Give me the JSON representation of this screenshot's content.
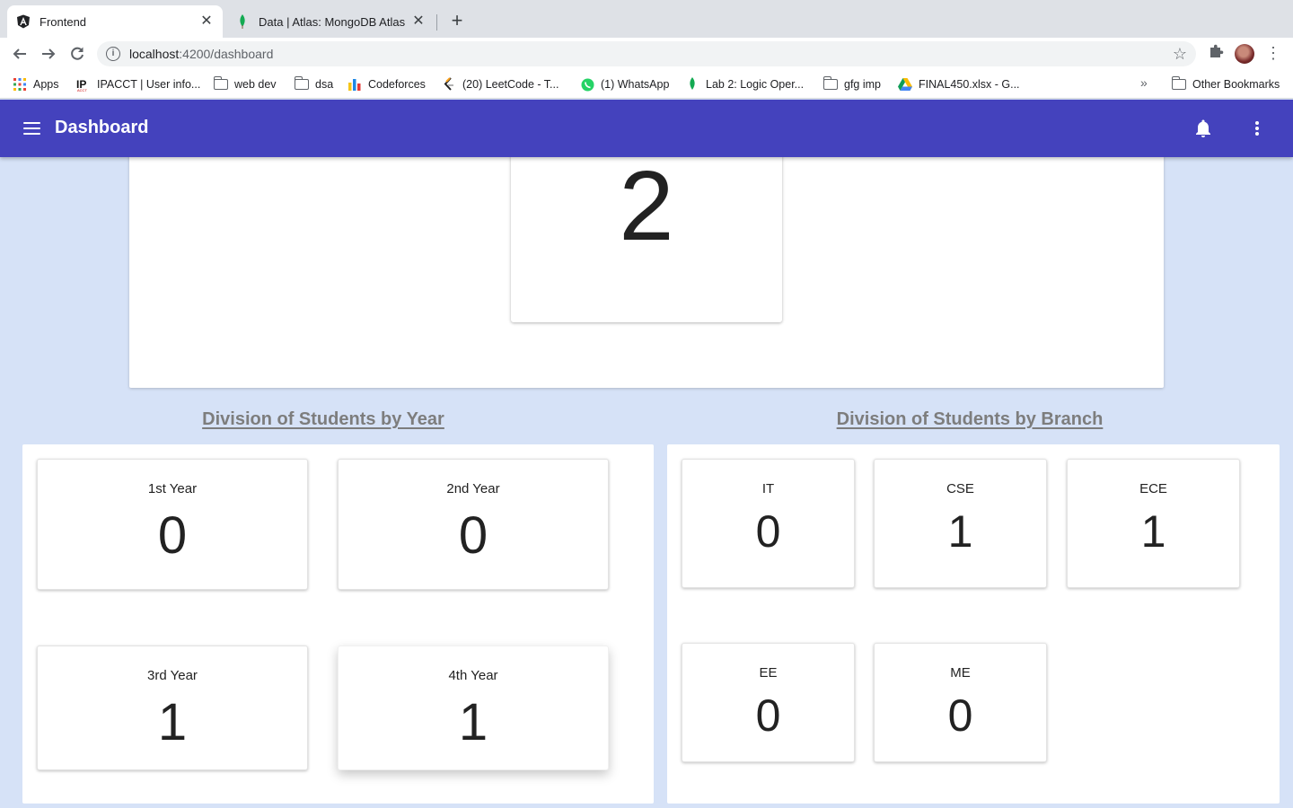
{
  "browser": {
    "tabs": [
      {
        "title": "Frontend",
        "icon": "angular-icon"
      },
      {
        "title": "Data | Atlas: MongoDB Atlas",
        "icon": "mongodb-leaf-icon"
      }
    ],
    "url_host": "localhost",
    "url_path": ":4200/dashboard",
    "bookmarks": [
      {
        "label": "Apps",
        "icon": "apps-grid-icon"
      },
      {
        "label": "IPACCT | User info...",
        "icon": "ipacct-icon"
      },
      {
        "label": "web dev",
        "icon": "folder-icon"
      },
      {
        "label": "dsa",
        "icon": "folder-icon"
      },
      {
        "label": "Codeforces",
        "icon": "codeforces-icon"
      },
      {
        "label": "(20) LeetCode - T...",
        "icon": "leetcode-icon"
      },
      {
        "label": "(1) WhatsApp",
        "icon": "whatsapp-icon"
      },
      {
        "label": "Lab 2: Logic Oper...",
        "icon": "mongodb-leaf-icon"
      },
      {
        "label": "gfg imp",
        "icon": "folder-icon"
      },
      {
        "label": "FINAL450.xlsx - G...",
        "icon": "google-drive-icon"
      }
    ],
    "other_bookmarks": "Other Bookmarks"
  },
  "appbar": {
    "title": "Dashboard",
    "bg_color": "#4442bd"
  },
  "total": {
    "value": "2"
  },
  "year_section": {
    "heading": "Division of Students by Year",
    "cards": [
      {
        "label": "1st Year",
        "value": "0"
      },
      {
        "label": "2nd Year",
        "value": "0"
      },
      {
        "label": "3rd Year",
        "value": "1"
      },
      {
        "label": "4th Year",
        "value": "1"
      }
    ]
  },
  "branch_section": {
    "heading": "Division of Students by Branch",
    "cards": [
      {
        "label": "IT",
        "value": "0"
      },
      {
        "label": "CSE",
        "value": "1"
      },
      {
        "label": "ECE",
        "value": "1"
      },
      {
        "label": "EE",
        "value": "0"
      },
      {
        "label": "ME",
        "value": "0"
      }
    ]
  }
}
